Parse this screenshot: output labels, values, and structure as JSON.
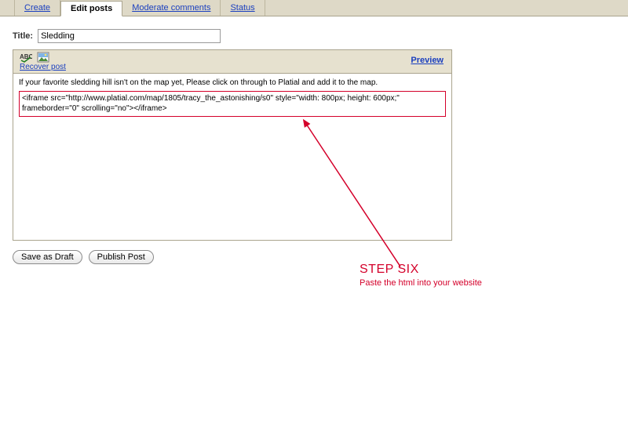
{
  "tabs": {
    "create": "Create",
    "edit_posts": "Edit posts",
    "moderate": "Moderate comments",
    "status": "Status"
  },
  "form": {
    "title_label": "Title:",
    "title_value": "Sledding"
  },
  "toolbar": {
    "recover": "Recover post",
    "preview": "Preview"
  },
  "pane": {
    "intro": "If your favorite sledding hill isn't on the map yet, Please click on through to Platial and add it to the map.",
    "code": "<iframe src=\"http://www.platial.com/map/1805/tracy_the_astonishing/s0\" style=\"width: 800px; height: 600px;\" frameborder=\"0\" scrolling=\"no\"></iframe>"
  },
  "buttons": {
    "draft": "Save as Draft",
    "publish": "Publish Post"
  },
  "annotation": {
    "heading": "STEP SIX",
    "sub": "Paste the html into your website"
  },
  "colors": {
    "accent_red": "#d4002a"
  }
}
